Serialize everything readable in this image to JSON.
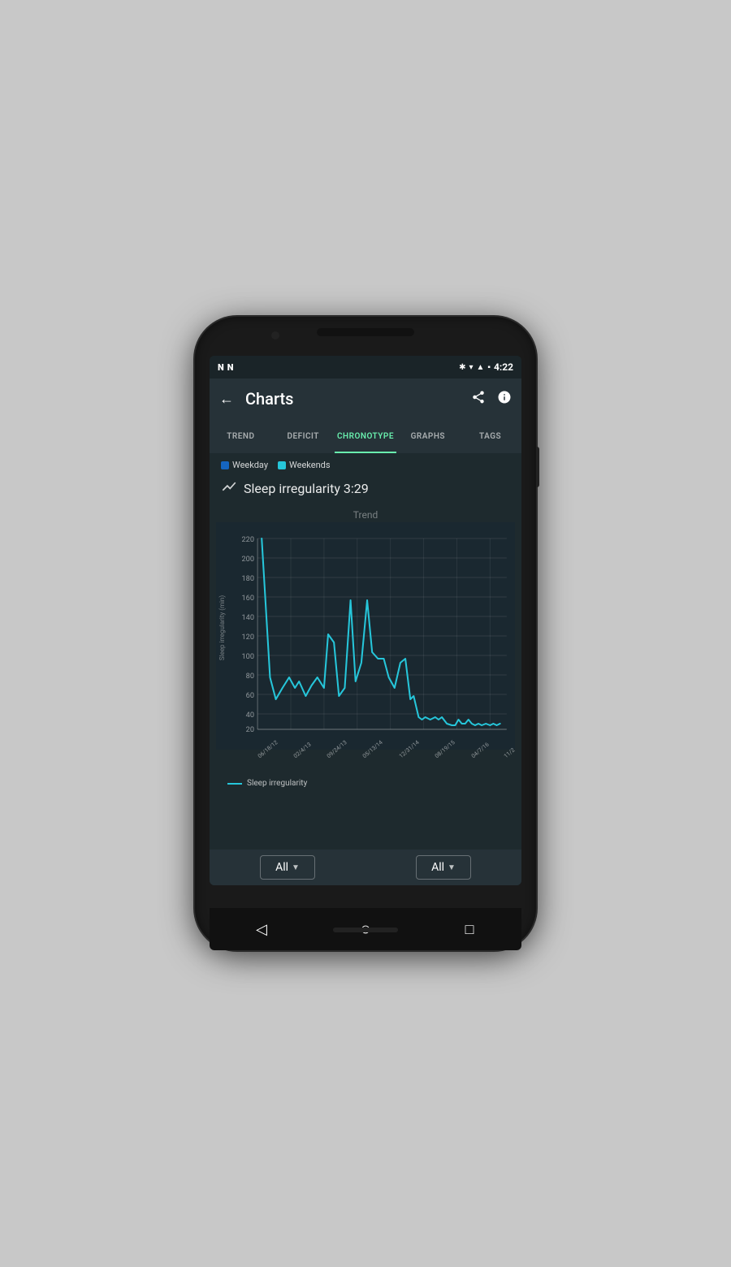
{
  "status_bar": {
    "time": "4:22",
    "icons_left": [
      "N",
      "N"
    ],
    "icons_right": [
      "bluetooth",
      "wifi",
      "signal",
      "battery"
    ]
  },
  "toolbar": {
    "title": "Charts",
    "back_label": "←",
    "share_label": "⮂",
    "info_label": "ℹ"
  },
  "tabs": [
    {
      "label": "TREND",
      "active": false
    },
    {
      "label": "DEFICIT",
      "active": false
    },
    {
      "label": "CHRONOTYPE",
      "active": true
    },
    {
      "label": "GRAPHS",
      "active": false
    },
    {
      "label": "TAGS",
      "active": false
    }
  ],
  "legend": [
    {
      "label": "Weekday",
      "color": "#1565c0"
    },
    {
      "label": "Weekends",
      "color": "#26c6da"
    }
  ],
  "sleep_irregularity": {
    "label": "Sleep irregularity 3:29",
    "icon": "↗"
  },
  "chart": {
    "title": "Trend",
    "y_axis_label": "Sleep irregularity (min)",
    "y_labels": [
      "220",
      "200",
      "180",
      "160",
      "140",
      "120",
      "100",
      "80",
      "60",
      "40",
      "20"
    ],
    "x_labels": [
      "06/18/12",
      "02/4/13",
      "09/24/13",
      "05/13/14",
      "12/31/14",
      "08/19/15",
      "04/7/16",
      "11/2"
    ],
    "legend_line": "Sleep irregularity",
    "color": "#26c6da"
  },
  "filters": [
    {
      "label": "All"
    },
    {
      "label": "All"
    }
  ],
  "nav": {
    "back": "◁",
    "home": "○",
    "recent": "□"
  }
}
